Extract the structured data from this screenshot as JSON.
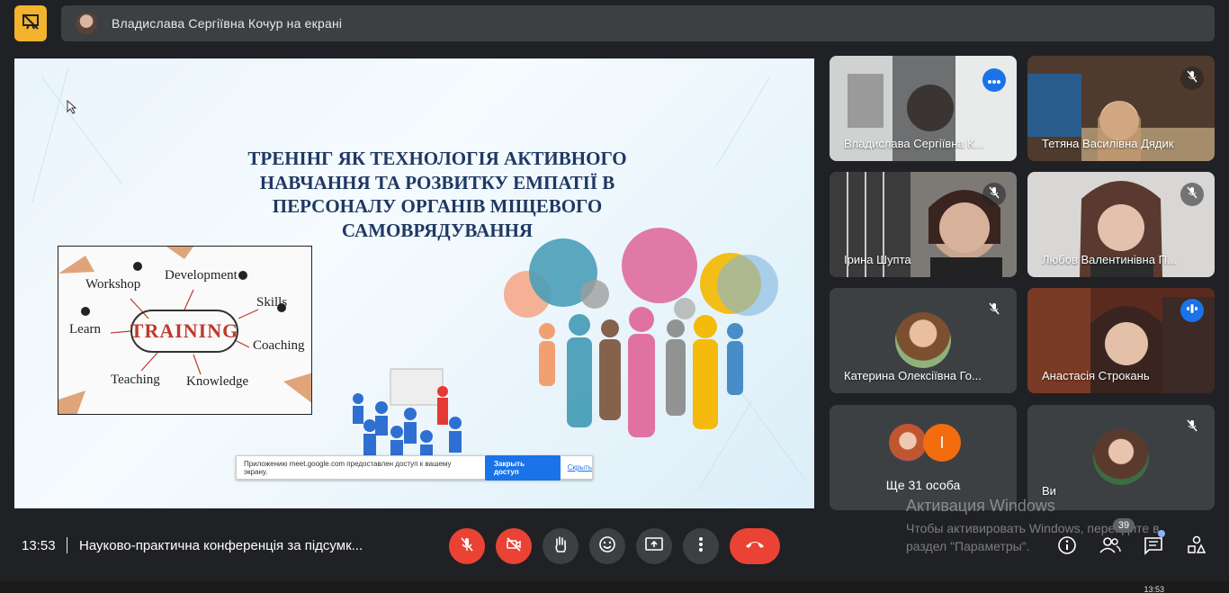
{
  "top": {
    "presenter_text": "Владислава Сергіївна Кочур на екрані",
    "logo_icon": "presentation-off-icon"
  },
  "presentation": {
    "title_lines": [
      "ТРЕНІНГ ЯК ТЕХНОЛОГІЯ АКТИВНОГО",
      "НАВЧАННЯ ТА РОЗВИТКУ ЕМПАТІЇ В",
      "ПЕРСОНАЛУ ОРГАНІВ МІЩЕВОГО",
      "САМОВРЯДУВАННЯ"
    ],
    "training_words": {
      "center": "TRAINING",
      "workshop": "Workshop",
      "development": "Development",
      "skills": "Skills",
      "learn": "Learn",
      "coaching": "Coaching",
      "teaching": "Teaching",
      "knowledge": "Knowledge"
    },
    "share_bar": {
      "text": "Приложению meet.google.com предоставлен доступ к вашему экрану.",
      "stop_label": "Закрыть доступ",
      "hide_label": "Скрыть"
    }
  },
  "participants": [
    {
      "name": "Владислава Сергіївна К...",
      "state": "active"
    },
    {
      "name": "Тетяна Василівна Дядик",
      "state": "muted"
    },
    {
      "name": "Ірина Шупта",
      "state": "muted"
    },
    {
      "name": "Любов Валентинівна П...",
      "state": "muted"
    },
    {
      "name": "Катерина Олексіївна Го...",
      "state": "muted"
    },
    {
      "name": "Анастасія Строкань",
      "state": "speaking"
    },
    {
      "name": "Ще 31 особа",
      "state": "others",
      "initial": "І"
    },
    {
      "name": "Ви",
      "state": "muted"
    }
  ],
  "bottom": {
    "time": "13:53",
    "meeting_title": "Науково-практична конференція за підсумк...",
    "participants_count": "39",
    "controls": [
      "mic-off-icon",
      "camera-off-icon",
      "raise-hand-icon",
      "emoji-icon",
      "present-icon",
      "more-icon",
      "hang-up-icon"
    ],
    "right_icons": [
      "info-icon",
      "people-icon",
      "chat-icon",
      "activities-icon"
    ]
  },
  "watermark": {
    "title": "Активация Windows",
    "line1": "Чтобы активировать Windows, перейдите в",
    "line2": "раздел \"Параметры\"."
  },
  "taskbar": {
    "time": "13:53"
  },
  "colors": {
    "background": "#202124",
    "tile": "#3c4043",
    "accent_blue": "#1a73e8",
    "danger_red": "#ea4335",
    "logo_yellow": "#f3b32c"
  }
}
